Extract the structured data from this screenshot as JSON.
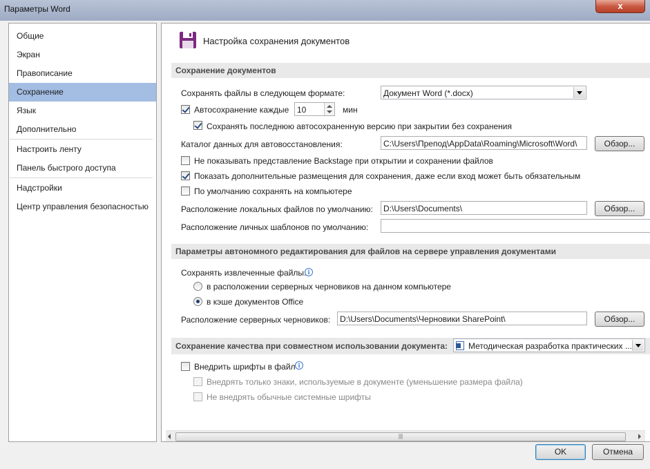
{
  "window": {
    "title": "Параметры Word",
    "close_label": "x"
  },
  "nav": {
    "items": [
      {
        "label": "Общие"
      },
      {
        "label": "Экран"
      },
      {
        "label": "Правописание"
      },
      {
        "label": "Сохранение",
        "selected": true
      },
      {
        "label": "Язык"
      },
      {
        "label": "Дополнительно"
      },
      {
        "label": "Настроить ленту"
      },
      {
        "label": "Панель быстрого доступа"
      },
      {
        "label": "Надстройки"
      },
      {
        "label": "Центр управления безопасностью"
      }
    ]
  },
  "page": {
    "heading": "Настройка сохранения документов",
    "icon": "floppy-disk-icon"
  },
  "save_docs": {
    "section_title": "Сохранение документов",
    "format_label": "Сохранять файлы в следующем формате:",
    "format_value": "Документ Word (*.docx)",
    "autosave_label": "Автосохранение каждые",
    "autosave_checked": true,
    "autosave_minutes": "10",
    "minutes_label": "мин",
    "keep_last_label": "Сохранять последнюю автосохраненную версию при закрытии без сохранения",
    "keep_last_checked": true,
    "autorecover_label": "Каталог данных для автовосстановления:",
    "autorecover_path": "C:\\Users\\Препод\\AppData\\Roaming\\Microsoft\\Word\\",
    "browse_label": "Обзор...",
    "no_backstage_label": "Не показывать представление Backstage при открытии и сохранении файлов",
    "no_backstage_checked": false,
    "show_places_label": "Показать дополнительные размещения для сохранения, даже если вход может быть обязательным",
    "show_places_checked": true,
    "default_computer_label": "По умолчанию сохранять на компьютере",
    "default_computer_checked": false,
    "local_files_label": "Расположение локальных файлов по умолчанию:",
    "local_files_path": "D:\\Users\\Documents\\",
    "templates_label": "Расположение личных шаблонов по умолчанию:",
    "templates_path": ""
  },
  "offline": {
    "section_title": "Параметры автономного редактирования для файлов на сервере управления документами",
    "save_checked_out_label": "Сохранять извлеченные файлы:",
    "option_server_drafts": "в расположении серверных черновиков на данном компьютере",
    "option_cache": "в кэше документов Office",
    "selected_option": "cache",
    "drafts_label": "Расположение серверных черновиков:",
    "drafts_path": "D:\\Users\\Documents\\Черновики SharePoint\\"
  },
  "quality": {
    "section_title": "Сохранение качества при совместном использовании документа:",
    "document_value": "Методическая разработка практических ...",
    "embed_fonts_label": "Внедрить шрифты в файл",
    "embed_fonts_checked": false,
    "only_used_label": "Внедрять только знаки, используемые в документе (уменьшение размера файла)",
    "no_system_label": "Не внедрять обычные системные шрифты"
  },
  "footer": {
    "ok_label": "OK",
    "cancel_label": "Отмена"
  }
}
